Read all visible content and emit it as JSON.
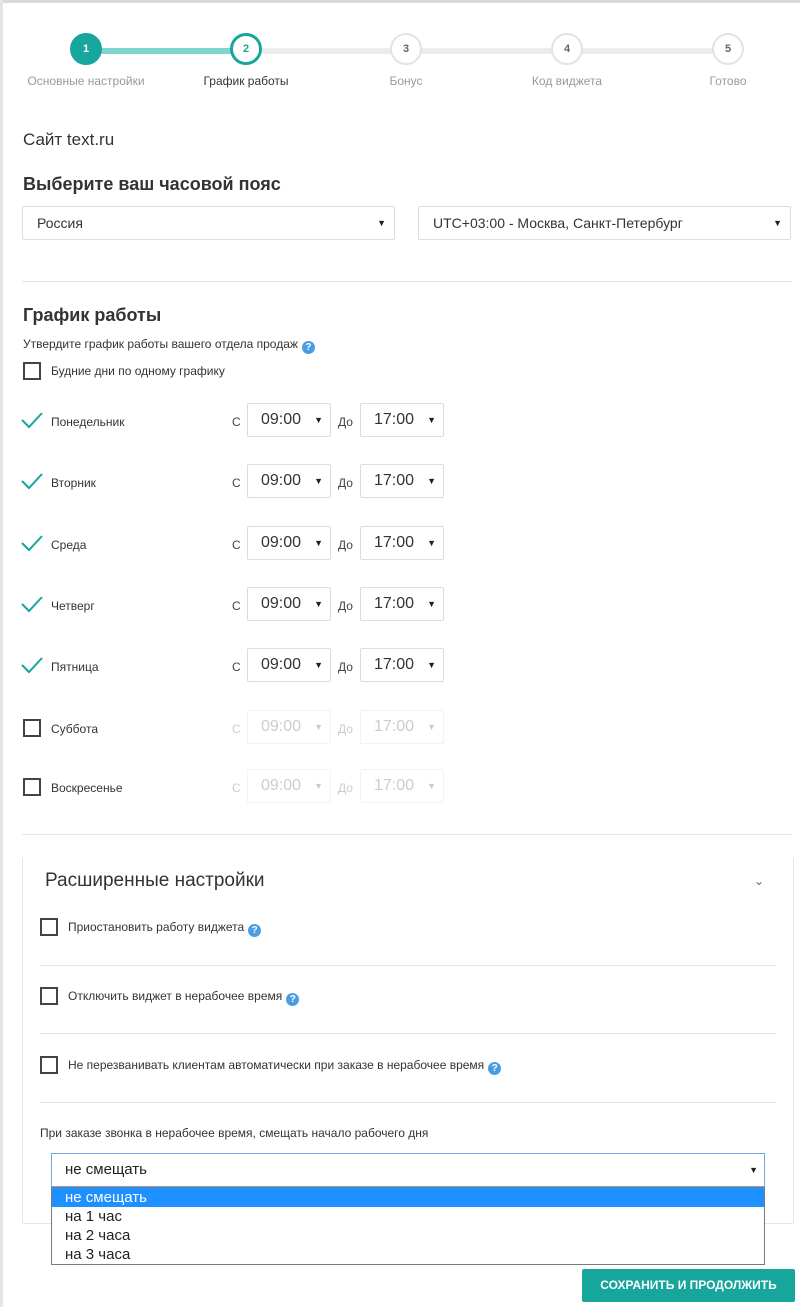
{
  "stepper": {
    "steps": [
      {
        "num": "1",
        "label": "Основные настройки"
      },
      {
        "num": "2",
        "label": "График работы"
      },
      {
        "num": "3",
        "label": "Бонус"
      },
      {
        "num": "4",
        "label": "Код виджета"
      },
      {
        "num": "5",
        "label": "Готово"
      }
    ],
    "current_step": 2
  },
  "site_title": "Сайт text.ru",
  "timezone": {
    "heading": "Выберите ваш часовой пояс",
    "country": "Россия",
    "zone": "UTC+03:00 - Москва, Санкт-Петербург"
  },
  "schedule": {
    "heading": "График работы",
    "hint": "Утвердите график работы вашего отдела продаж",
    "same_weekdays_label": "Будние дни по одному графику",
    "from_label": "С",
    "to_label": "До",
    "days": [
      {
        "name": "Понедельник",
        "enabled": true,
        "from": "09:00",
        "to": "17:00"
      },
      {
        "name": "Вторник",
        "enabled": true,
        "from": "09:00",
        "to": "17:00"
      },
      {
        "name": "Среда",
        "enabled": true,
        "from": "09:00",
        "to": "17:00"
      },
      {
        "name": "Четверг",
        "enabled": true,
        "from": "09:00",
        "to": "17:00"
      },
      {
        "name": "Пятница",
        "enabled": true,
        "from": "09:00",
        "to": "17:00"
      },
      {
        "name": "Суббота",
        "enabled": false,
        "from": "09:00",
        "to": "17:00"
      },
      {
        "name": "Воскресенье",
        "enabled": false,
        "from": "09:00",
        "to": "17:00"
      }
    ]
  },
  "advanced": {
    "title": "Расширенные настройки",
    "options": [
      "Приостановить работу виджета",
      "Отключить виджет в нерабочее время",
      "Не перезванивать клиентам автоматически при заказе в нерабочее время"
    ],
    "shift_label": "При заказе звонка в нерабочее время, смещать начало рабочего дня",
    "shift_value": "не смещать",
    "shift_options": [
      "не смещать",
      "на 1 час",
      "на 2 часа",
      "на 3 часа"
    ]
  },
  "save_button": "СОХРАНИТЬ И ПРОДОЛЖИТЬ",
  "colors": {
    "accent": "#17a69b",
    "help": "#4a9de3",
    "selected_option": "#1e90ff"
  }
}
